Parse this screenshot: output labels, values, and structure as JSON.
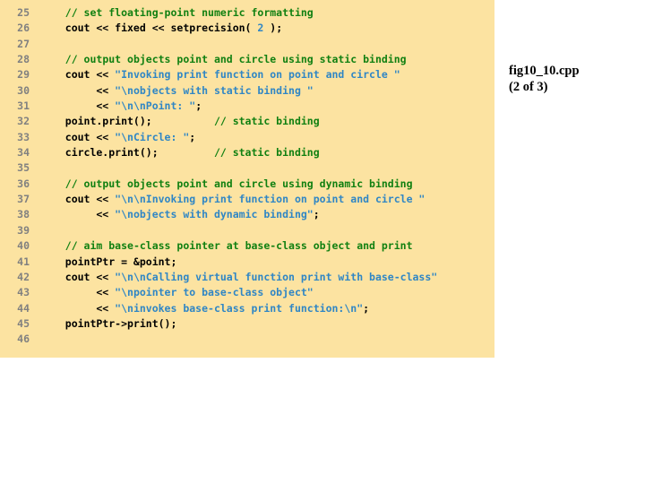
{
  "slide": {
    "background_color": "#ffffff",
    "panel_color": "#fce3a1"
  },
  "caption": {
    "file_name": "fig10_10.cpp",
    "part": "(2 of 3)"
  },
  "colors": {
    "comment": "#118011",
    "string": "#2f86c5",
    "number": "#2f86c5",
    "plain": "#000000",
    "line_number": "#808080",
    "panel": "#fce3a1"
  },
  "code": {
    "language": "cpp",
    "first_line_number": 25,
    "last_line_number": 46,
    "lines": [
      {
        "number": "25",
        "text": "   // set floating-point numeric formatting",
        "tokens": [
          {
            "t": "   ",
            "c": "pln"
          },
          {
            "t": "// set floating-point numeric formatting",
            "c": "com"
          }
        ]
      },
      {
        "number": "26",
        "text": "   cout << fixed << setprecision( 2 );",
        "tokens": [
          {
            "t": "   cout << fixed << setprecision( ",
            "c": "pln"
          },
          {
            "t": "2",
            "c": "num"
          },
          {
            "t": " );",
            "c": "pln"
          }
        ]
      },
      {
        "number": "27",
        "text": "",
        "tokens": []
      },
      {
        "number": "28",
        "text": "   // output objects point and circle using static binding",
        "tokens": [
          {
            "t": "   ",
            "c": "pln"
          },
          {
            "t": "// output objects point and circle using static binding",
            "c": "com"
          }
        ]
      },
      {
        "number": "29",
        "text": "   cout << \"Invoking print function on point and circle \"",
        "tokens": [
          {
            "t": "   cout << ",
            "c": "pln"
          },
          {
            "t": "\"Invoking print function on point and circle \"",
            "c": "str"
          }
        ]
      },
      {
        "number": "30",
        "text": "        << \"\\nobjects with static binding \"",
        "tokens": [
          {
            "t": "        << ",
            "c": "pln"
          },
          {
            "t": "\"\\nobjects with static binding \"",
            "c": "str"
          }
        ]
      },
      {
        "number": "31",
        "text": "        << \"\\n\\nPoint: \";",
        "tokens": [
          {
            "t": "        << ",
            "c": "pln"
          },
          {
            "t": "\"\\n\\nPoint: \"",
            "c": "str"
          },
          {
            "t": ";",
            "c": "pln"
          }
        ]
      },
      {
        "number": "32",
        "text": "   point.print();          // static binding",
        "tokens": [
          {
            "t": "   point.print();          ",
            "c": "pln"
          },
          {
            "t": "// static binding",
            "c": "com"
          }
        ]
      },
      {
        "number": "33",
        "text": "   cout << \"\\nCircle: \";",
        "tokens": [
          {
            "t": "   cout << ",
            "c": "pln"
          },
          {
            "t": "\"\\nCircle: \"",
            "c": "str"
          },
          {
            "t": ";",
            "c": "pln"
          }
        ]
      },
      {
        "number": "34",
        "text": "   circle.print();         // static binding",
        "tokens": [
          {
            "t": "   circle.print();         ",
            "c": "pln"
          },
          {
            "t": "// static binding",
            "c": "com"
          }
        ]
      },
      {
        "number": "35",
        "text": "",
        "tokens": []
      },
      {
        "number": "36",
        "text": "   // output objects point and circle using dynamic binding",
        "tokens": [
          {
            "t": "   ",
            "c": "pln"
          },
          {
            "t": "// output objects point and circle using dynamic binding",
            "c": "com"
          }
        ]
      },
      {
        "number": "37",
        "text": "   cout << \"\\n\\nInvoking print function on point and circle \"",
        "tokens": [
          {
            "t": "   cout << ",
            "c": "pln"
          },
          {
            "t": "\"\\n\\nInvoking print function on point and circle \"",
            "c": "str"
          }
        ]
      },
      {
        "number": "38",
        "text": "        << \"\\nobjects with dynamic binding\";",
        "tokens": [
          {
            "t": "        << ",
            "c": "pln"
          },
          {
            "t": "\"\\nobjects with dynamic binding\"",
            "c": "str"
          },
          {
            "t": ";",
            "c": "pln"
          }
        ]
      },
      {
        "number": "39",
        "text": "",
        "tokens": []
      },
      {
        "number": "40",
        "text": "   // aim base-class pointer at base-class object and print",
        "tokens": [
          {
            "t": "   ",
            "c": "pln"
          },
          {
            "t": "// aim base-class pointer at base-class object and print",
            "c": "com"
          }
        ]
      },
      {
        "number": "41",
        "text": "   pointPtr = &point;",
        "tokens": [
          {
            "t": "   pointPtr = &point;",
            "c": "pln"
          }
        ]
      },
      {
        "number": "42",
        "text": "   cout << \"\\n\\nCalling virtual function print with base-class\"",
        "tokens": [
          {
            "t": "   cout << ",
            "c": "pln"
          },
          {
            "t": "\"\\n\\nCalling virtual function print with base-class\"",
            "c": "str"
          }
        ]
      },
      {
        "number": "43",
        "text": "        << \"\\npointer to base-class object\"",
        "tokens": [
          {
            "t": "        << ",
            "c": "pln"
          },
          {
            "t": "\"\\npointer to base-class object\"",
            "c": "str"
          }
        ]
      },
      {
        "number": "44",
        "text": "        << \"\\ninvokes base-class print function:\\n\";",
        "tokens": [
          {
            "t": "        << ",
            "c": "pln"
          },
          {
            "t": "\"\\ninvokes base-class print function:\\n\"",
            "c": "str"
          },
          {
            "t": ";",
            "c": "pln"
          }
        ]
      },
      {
        "number": "45",
        "text": "   pointPtr->print();",
        "tokens": [
          {
            "t": "   pointPtr->print();",
            "c": "pln"
          }
        ]
      },
      {
        "number": "46",
        "text": "",
        "tokens": []
      }
    ]
  }
}
